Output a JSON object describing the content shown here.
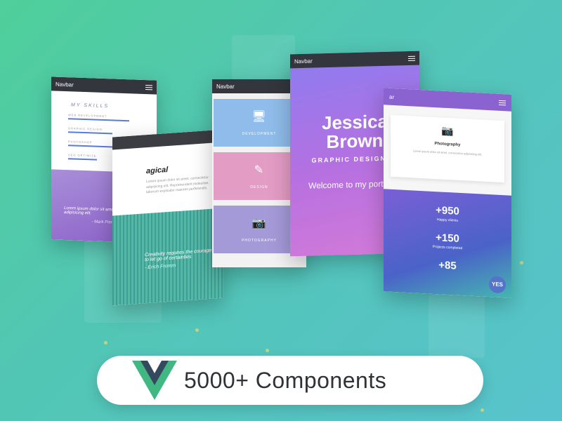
{
  "skills_card": {
    "navbar": "Navbar",
    "title": "MY SKILLS",
    "skills": [
      {
        "label": "WEB DEVELOPMENT",
        "level": 0.85
      },
      {
        "label": "GRAPHIC DESIGN",
        "level": 0.62
      },
      {
        "label": "PHOTOSHOP",
        "level": 0.7
      },
      {
        "label": "SEO OPTIMIZE",
        "level": 0.4
      }
    ],
    "quote": "Lorem ipsum dolor sit amet, consectetur adipisicing elit.",
    "author": "- Mark Pierson"
  },
  "magic_card": {
    "title": "agical",
    "text": "Lorem ipsum dolor sit amet, consectetur adipisicing elit. Reprehenderit molestiae, laborum explicabo maiores perferendis.",
    "quote": "Creativity requires the courage to let go of certainties",
    "author": "- Erich Fromm"
  },
  "services_card": {
    "navbar": "Navbar",
    "items": [
      {
        "label": "DEVELOPMENT",
        "icon": "monitor-icon",
        "color": "#8fbcea"
      },
      {
        "label": "DESIGN",
        "icon": "pencil-icon",
        "color": "#e39cc4"
      },
      {
        "label": "PHOTOGRAPHY",
        "icon": "camera-icon",
        "color": "#a59ad8"
      }
    ]
  },
  "hero_card": {
    "navbar": "Navbar",
    "first_name": "Jessica",
    "last_name": "Brown",
    "role": "GRAPHIC DESIGNER",
    "welcome": "Welcome to my portfolio!"
  },
  "stats_card": {
    "navbar_fragment": "ar",
    "photo_title": "Photography",
    "photo_text": "Lorem ipsum dolor sit amet, consectetur adipisicing elit.",
    "stats": [
      {
        "value": "+950",
        "label": "Happy clients"
      },
      {
        "value": "+150",
        "label": "Projects completed"
      },
      {
        "value": "+85",
        "label": ""
      }
    ],
    "badge": "YES"
  },
  "footer": {
    "label": "5000+ Components"
  }
}
